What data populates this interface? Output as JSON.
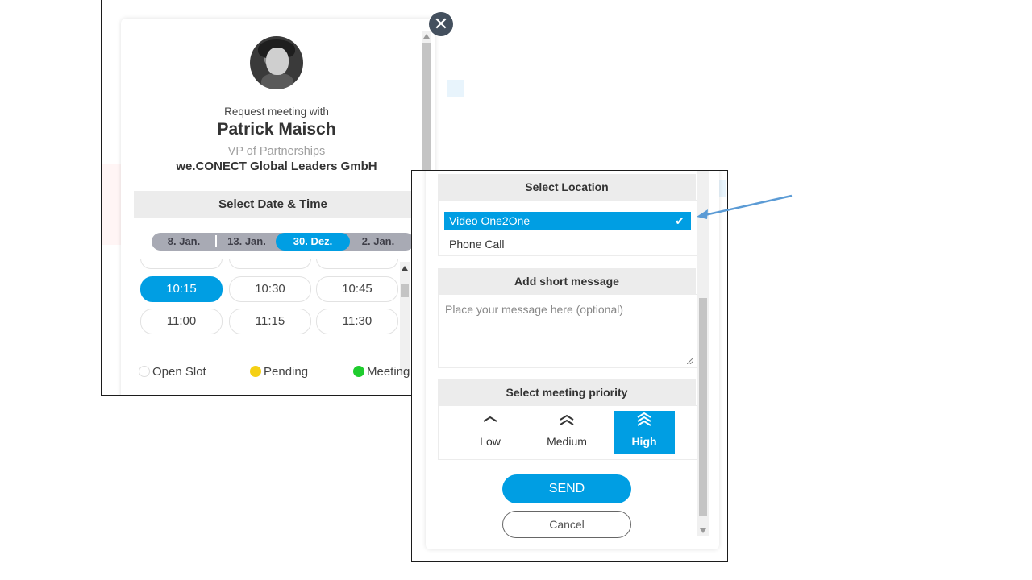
{
  "meeting_card": {
    "request_label": "Request meeting with",
    "name": "Patrick Maisch",
    "role": "VP of Partnerships",
    "company": "we.CONECT Global Leaders GmbH",
    "close_icon": "close-icon",
    "date_section_title": "Select Date & Time",
    "dates": [
      "8. Jan.",
      "13. Jan.",
      "30. Dez.",
      "2. Jan."
    ],
    "active_date": "30. Dez.",
    "time_slots": [
      {
        "label": "10:15",
        "active": true
      },
      {
        "label": "10:30",
        "active": false
      },
      {
        "label": "10:45",
        "active": false
      },
      {
        "label": "11:00",
        "active": false
      },
      {
        "label": "11:15",
        "active": false
      },
      {
        "label": "11:30",
        "active": false
      }
    ],
    "legend": [
      {
        "label": "Open Slot",
        "color": "#ffffff"
      },
      {
        "label": "Pending",
        "color": "#f5d014"
      },
      {
        "label": "Meeting",
        "color": "#1fcc2e"
      }
    ]
  },
  "request_form": {
    "location_title": "Select Location",
    "locations": [
      {
        "label": "Video One2One",
        "selected": true
      },
      {
        "label": "Phone Call",
        "selected": false
      }
    ],
    "message_title": "Add short message",
    "message_placeholder": "Place your message here (optional)",
    "priority_title": "Select meeting priority",
    "priorities": [
      {
        "label": "Low",
        "icon": "chevron-up-icon",
        "selected": false
      },
      {
        "label": "Medium",
        "icon": "double-chevron-up-icon",
        "selected": false
      },
      {
        "label": "High",
        "icon": "triple-chevron-up-icon",
        "selected": true
      }
    ],
    "send_label": "SEND",
    "cancel_label": "Cancel"
  },
  "colors": {
    "accent": "#009ee3",
    "date_bar": "#a8aab4",
    "section_header": "#ececec",
    "close_button": "#44505e",
    "arrow": "#5b9bd5"
  }
}
